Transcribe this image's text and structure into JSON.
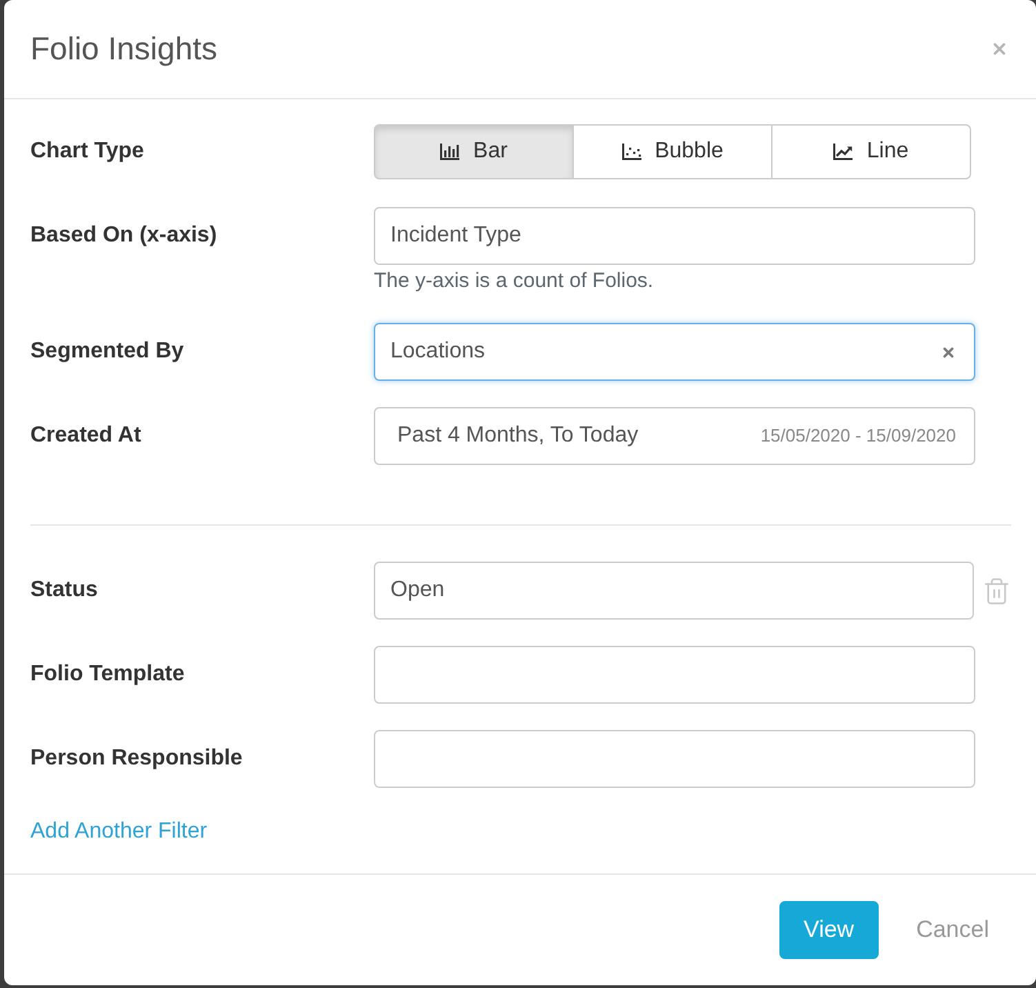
{
  "dialog": {
    "title": "Folio Insights"
  },
  "chart_type": {
    "label": "Chart Type",
    "options": [
      {
        "label": "Bar",
        "kind": "bar",
        "selected": true
      },
      {
        "label": "Bubble",
        "kind": "bubble",
        "selected": false
      },
      {
        "label": "Line",
        "kind": "line",
        "selected": false
      }
    ]
  },
  "fields": [
    {
      "kind": "select",
      "label": "Based On (x-axis)",
      "value": "Incident Type",
      "help": "The y-axis is a count of Folios.",
      "focused": false,
      "clear_button": false
    },
    {
      "kind": "select",
      "label": "Segmented By",
      "value": "Locations",
      "focused": true,
      "clear_button": true
    },
    {
      "kind": "date_range",
      "label": "Created At",
      "value": "Past 4 Months, To Today",
      "range": "15/05/2020 - 15/09/2020",
      "focused": false,
      "clear_button": false
    }
  ],
  "filters": [
    {
      "label": "Status",
      "value": "Open",
      "removable": true
    },
    {
      "label": "Folio Template",
      "removable": false
    },
    {
      "label": "Person Responsible",
      "removable": false
    }
  ],
  "add_filter_link": "Add Another Filter",
  "footer": {
    "buttons": [
      {
        "label": "View",
        "kind": "primary"
      },
      {
        "label": "Cancel",
        "kind": "link"
      }
    ]
  }
}
